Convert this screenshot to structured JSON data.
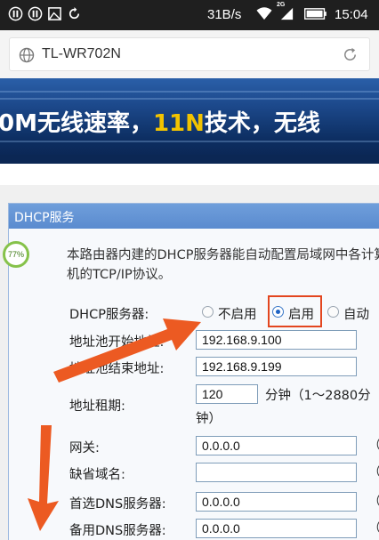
{
  "status_bar": {
    "speed": "31B/s",
    "network": "2G",
    "time": "15:04",
    "icons": [
      "notification-icon-1",
      "pause-icon",
      "image-icon",
      "sync-icon",
      "wifi-icon",
      "signal-icon",
      "battery-icon"
    ]
  },
  "address_bar": {
    "url": "TL-WR702N",
    "icons": [
      "globe-icon",
      "reload-icon"
    ]
  },
  "banner": {
    "text_part1": "0M无线速率，",
    "text_highlight": "11N",
    "text_part2": "技术，无线"
  },
  "panel": {
    "title": "DHCP服务",
    "badge": "77%",
    "intro": "本路由器内建的DHCP服务器能自动配置局域网中各计算机的TCP/IP协议。"
  },
  "form": {
    "dhcp_server_label": "DHCP服务器:",
    "options": [
      {
        "label": "不启用",
        "selected": false
      },
      {
        "label": "启用",
        "selected": true
      },
      {
        "label": "自动",
        "selected": false
      }
    ],
    "pool_start_label": "地址池开始地址:",
    "pool_start_value": "192.168.9.100",
    "pool_end_label": "地址池结束地址:",
    "pool_end_value": "192.168.9.199",
    "lease_label": "地址租期:",
    "lease_value": "120",
    "lease_unit": "分钟（1～2880分",
    "lease_unit_cont": "钟）",
    "gateway_label": "网关:",
    "gateway_value": "0.0.0.0",
    "domain_label": "缺省域名:",
    "domain_value": "",
    "dns1_label": "首选DNS服务器:",
    "dns1_value": "0.0.0.0",
    "dns2_label": "备用DNS服务器:",
    "dns2_value": "0.0.0.0",
    "paren": "（"
  },
  "colors": {
    "panel_header": "#5a8bcf",
    "highlight_box": "#e3461f",
    "arrow": "#ec5a22",
    "banner_highlight": "#f2c300"
  }
}
